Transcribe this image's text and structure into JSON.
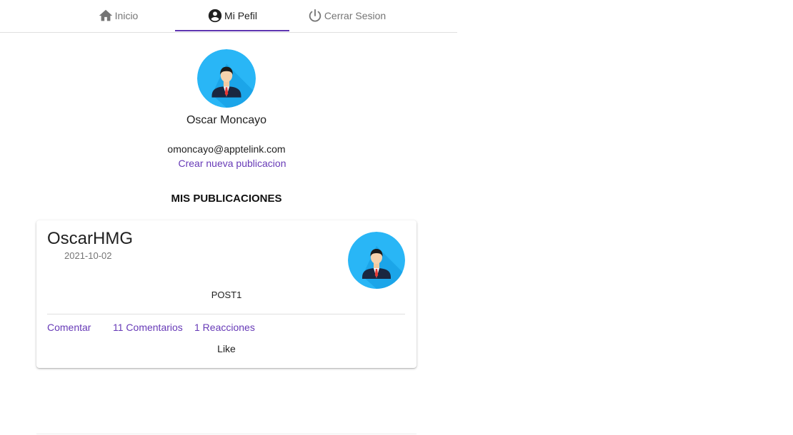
{
  "nav": {
    "tabs": [
      {
        "label": "Inicio",
        "icon": "home-icon"
      },
      {
        "label": "Mi Pefil",
        "icon": "account-circle-icon"
      },
      {
        "label": "Cerrar Sesion",
        "icon": "power-icon"
      }
    ],
    "active_tab": "Mi Pefil"
  },
  "profile": {
    "name": "Oscar Moncayo",
    "email": "omoncayo@apptelink.com",
    "create_post_link": "Crear nueva publicacion",
    "avatar_icon": "businessman-avatar-icon"
  },
  "publications": {
    "section_title": "MIS PUBLICACIONES",
    "posts": [
      {
        "username": "OscarHMG",
        "date": "2021-10-02",
        "content": "POST1",
        "comment_label": "Comentar",
        "comments_count_label": "11 Comentarios",
        "reactions_count_label": "1 Reacciones",
        "like_label": "Like"
      }
    ]
  },
  "colors": {
    "accent": "#673ab7",
    "tab_indicator": "#5e35b1",
    "avatar_bg": "#29b6f6"
  }
}
